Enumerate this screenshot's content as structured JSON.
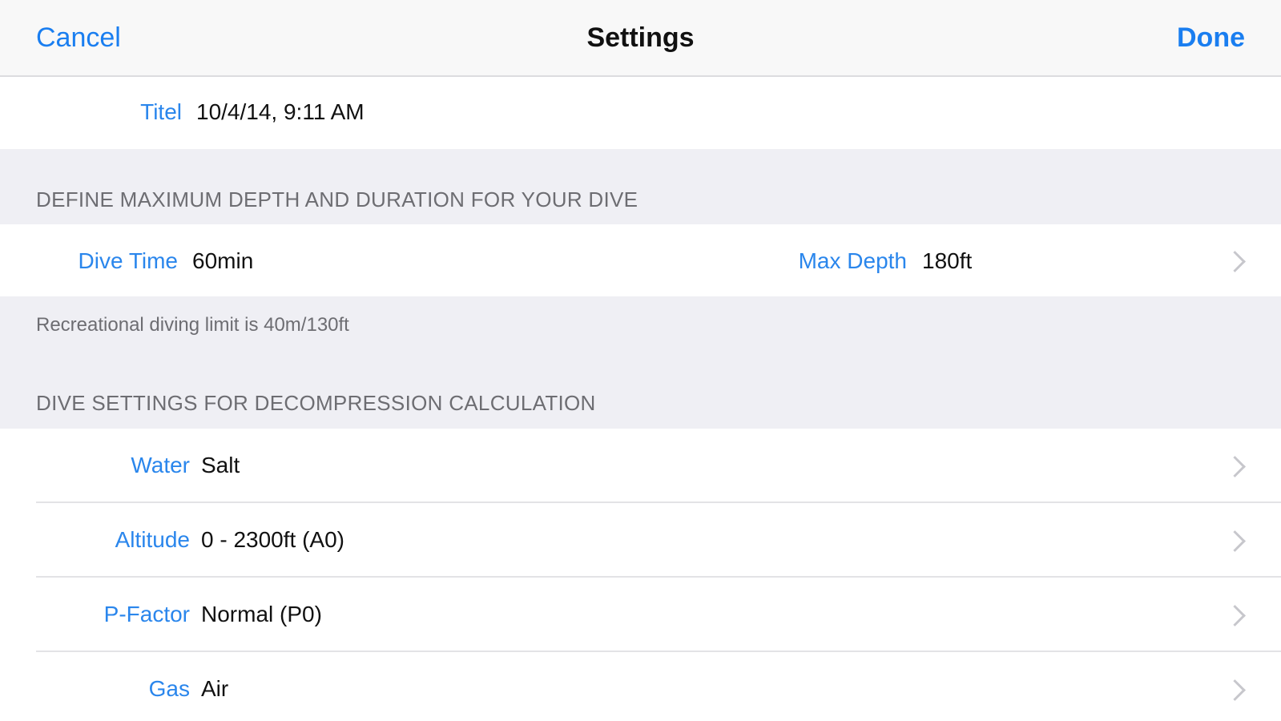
{
  "navbar": {
    "cancel_label": "Cancel",
    "title": "Settings",
    "done_label": "Done"
  },
  "title_row": {
    "label": "Titel",
    "value": "10/4/14, 9:11 AM"
  },
  "section_depth": {
    "header": "DEFINE MAXIMUM DEPTH AND DURATION FOR YOUR DIVE",
    "dive_time_label": "Dive Time",
    "dive_time_value": "60min",
    "max_depth_label": "Max Depth",
    "max_depth_value": "180ft",
    "footer": "Recreational diving limit is 40m/130ft"
  },
  "section_deco": {
    "header": "DIVE SETTINGS FOR DECOMPRESSION CALCULATION",
    "rows": [
      {
        "label": "Water",
        "value": "Salt"
      },
      {
        "label": "Altitude",
        "value": "0 - 2300ft (A0)"
      },
      {
        "label": "P-Factor",
        "value": "Normal (P0)"
      },
      {
        "label": "Gas",
        "value": "Air"
      }
    ]
  },
  "colors": {
    "accent": "#1a7ef0",
    "grouped_background": "#efeff4",
    "cell_background": "#ffffff",
    "secondary_text": "#6d6d72"
  },
  "icons": {
    "disclosure": "chevron-right-icon"
  }
}
